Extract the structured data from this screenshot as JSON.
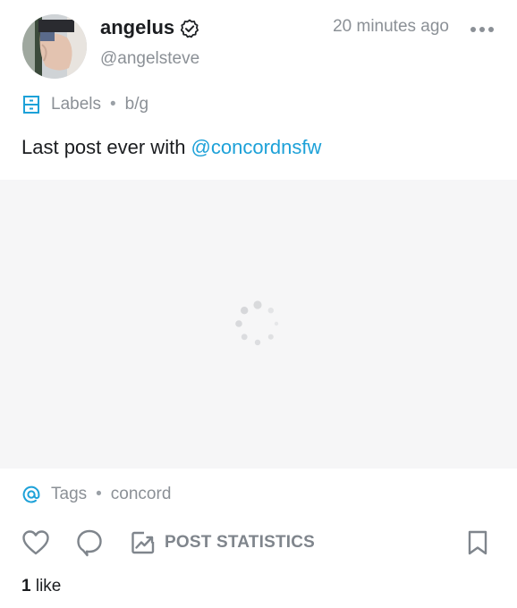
{
  "post": {
    "author": {
      "display_name": "angelus",
      "username": "@angelsteve",
      "verified": true
    },
    "timestamp": "20 minutes ago",
    "labels": {
      "icon": "labels-icon",
      "title": "Labels",
      "separator": "•",
      "value": "b/g"
    },
    "text": {
      "prefix": "Last post ever with ",
      "mention": "@concordnsfw"
    },
    "media": {
      "state": "loading",
      "icon": "spinner-icon"
    },
    "tags": {
      "icon": "at-icon",
      "title": "Tags",
      "separator": "•",
      "value": "concord"
    },
    "actions": {
      "stats_label": "POST STATISTICS"
    },
    "likes": {
      "count": "1",
      "label": " like"
    }
  },
  "colors": {
    "accent": "#1da1d8",
    "muted_text": "#8b9096",
    "primary_text": "#1b1d20",
    "media_bg": "#f6f6f7"
  }
}
